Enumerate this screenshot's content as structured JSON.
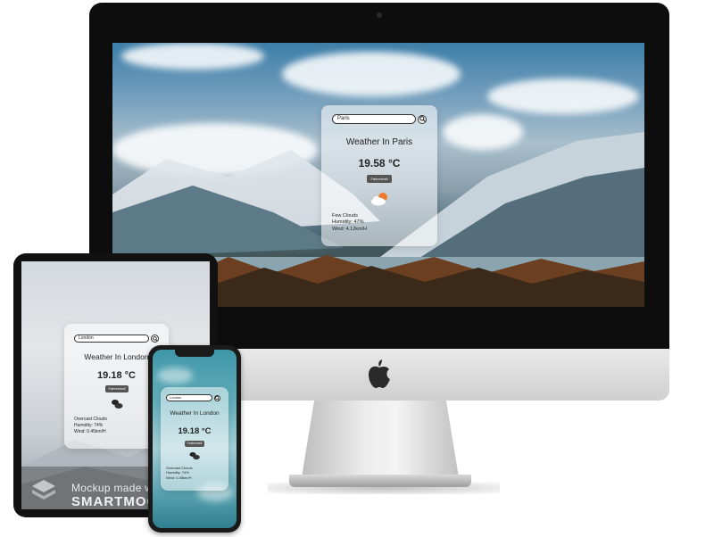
{
  "desktop": {
    "search_value": "Paris",
    "title": "Weather In Paris",
    "temperature": "19.58 °C",
    "unit_button": "Fahrenheit",
    "description": "Few Clouds",
    "humidity": "Humidity: 47%",
    "wind": "Wind: 4.12km/H",
    "icon": "partly-cloudy-icon"
  },
  "tablet": {
    "search_value": "London",
    "title": "Weather In London",
    "temperature": "19.18 °C",
    "unit_button": "Fahrenheit",
    "description": "Overcast Clouds",
    "humidity": "Humidity: 74%",
    "wind": "Wind: 0.45km/H",
    "icon": "overcast-clouds-icon"
  },
  "phone": {
    "search_value": "London",
    "title": "Weather In London",
    "temperature": "19.18 °C",
    "unit_button": "Fahrenheit",
    "description": "Overcast Clouds",
    "humidity": "Humidity: 74%",
    "wind": "Wind: 0.45km/H",
    "icon": "overcast-clouds-icon"
  },
  "watermark": {
    "line1": "Mockup made with",
    "line2": "SMARTMOCKUPS"
  },
  "brand_icon": "apple-logo-icon"
}
